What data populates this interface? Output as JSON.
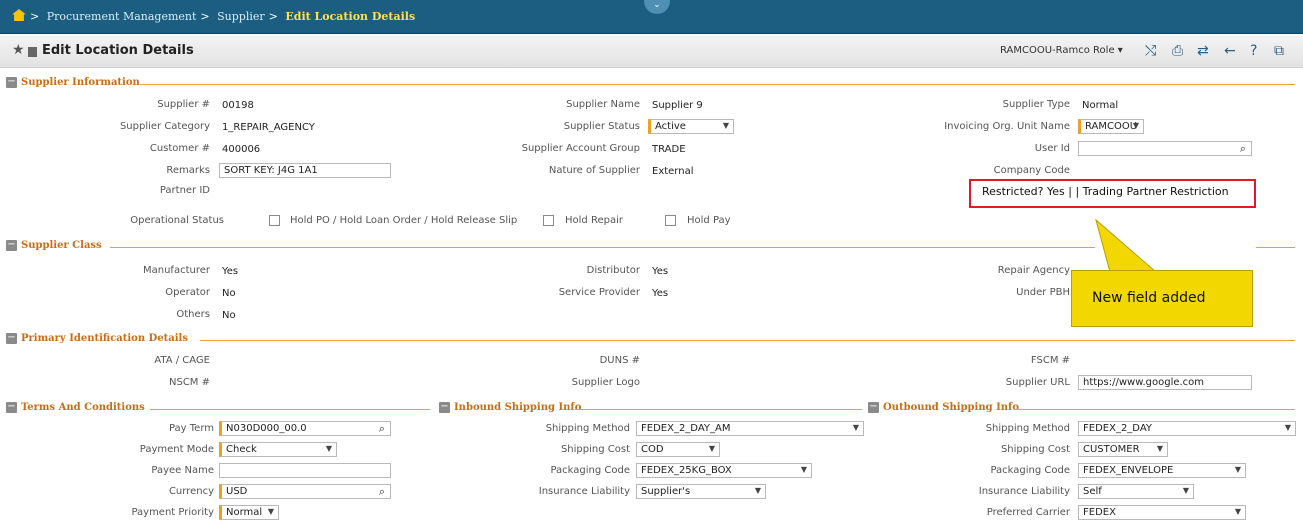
{
  "breadcrumb": {
    "items": [
      "Procurement Management",
      "Supplier"
    ],
    "current": "Edit Location Details"
  },
  "title": "Edit Location Details",
  "toolbar": {
    "role": "RAMCOOU-Ramco Role"
  },
  "sections": {
    "supplier_info": "Supplier Information",
    "supplier_class": "Supplier Class",
    "primary_id": "Primary Identification Details",
    "terms": "Terms And Conditions",
    "inbound": "Inbound Shipping Info",
    "outbound": "Outbound Shipping Info"
  },
  "supplier_info": {
    "supplier_no_label": "Supplier #",
    "supplier_no": "00198",
    "supplier_category_label": "Supplier Category",
    "supplier_category": "1_REPAIR_AGENCY",
    "customer_no_label": "Customer #",
    "customer_no": "400006",
    "remarks_label": "Remarks",
    "remarks": "SORT KEY: J4G 1A1",
    "partner_id_label": "Partner ID",
    "supplier_name_label": "Supplier Name",
    "supplier_name": "Supplier 9",
    "supplier_status_label": "Supplier Status",
    "supplier_status": "Active",
    "account_group_label": "Supplier Account Group",
    "account_group": "TRADE",
    "nature_label": "Nature of Supplier",
    "nature": "External",
    "supplier_type_label": "Supplier Type",
    "supplier_type": "Normal",
    "invoicing_ou_label": "Invoicing Org. Unit Name",
    "invoicing_ou": "RAMCOOU",
    "user_id_label": "User Id",
    "user_id": "",
    "company_code_label": "Company Code",
    "restricted_text": "Restricted?   Yes | | Trading Partner Restriction",
    "op_status_label": "Operational Status",
    "hold_po_label": "Hold PO / Hold Loan Order / Hold Release Slip",
    "hold_repair_label": "Hold Repair",
    "hold_pay_label": "Hold Pay"
  },
  "supplier_class": {
    "manufacturer_label": "Manufacturer",
    "manufacturer": "Yes",
    "operator_label": "Operator",
    "operator": "No",
    "others_label": "Others",
    "others": "No",
    "distributor_label": "Distributor",
    "distributor": "Yes",
    "service_provider_label": "Service Provider",
    "service_provider": "Yes",
    "repair_agency_label": "Repair Agency",
    "under_pbh_label": "Under PBH"
  },
  "primary_id": {
    "ata_label": "ATA / CAGE",
    "nscm_label": "NSCM #",
    "duns_label": "DUNS #",
    "logo_label": "Supplier Logo",
    "fscm_label": "FSCM #",
    "url_label": "Supplier URL",
    "url": "https://www.google.com"
  },
  "terms": {
    "pay_term_label": "Pay Term",
    "pay_term": "N030D000_00.0",
    "payment_mode_label": "Payment Mode",
    "payment_mode": "Check",
    "payee_label": "Payee Name",
    "payee": "",
    "currency_label": "Currency",
    "currency": "USD",
    "priority_label": "Payment Priority",
    "priority": "Normal"
  },
  "inbound": {
    "method_label": "Shipping Method",
    "method": "FEDEX_2_DAY_AM",
    "cost_label": "Shipping Cost",
    "cost": "COD",
    "packaging_label": "Packaging Code",
    "packaging": "FEDEX_25KG_BOX",
    "insurance_label": "Insurance Liability",
    "insurance": "Supplier's"
  },
  "outbound": {
    "method_label": "Shipping Method",
    "method": "FEDEX_2_DAY",
    "cost_label": "Shipping Cost",
    "cost": "CUSTOMER",
    "packaging_label": "Packaging Code",
    "packaging": "FEDEX_ENVELOPE",
    "insurance_label": "Insurance Liability",
    "insurance": "Self",
    "carrier_label": "Preferred Carrier",
    "carrier": "FEDEX"
  },
  "callout": "New field added"
}
